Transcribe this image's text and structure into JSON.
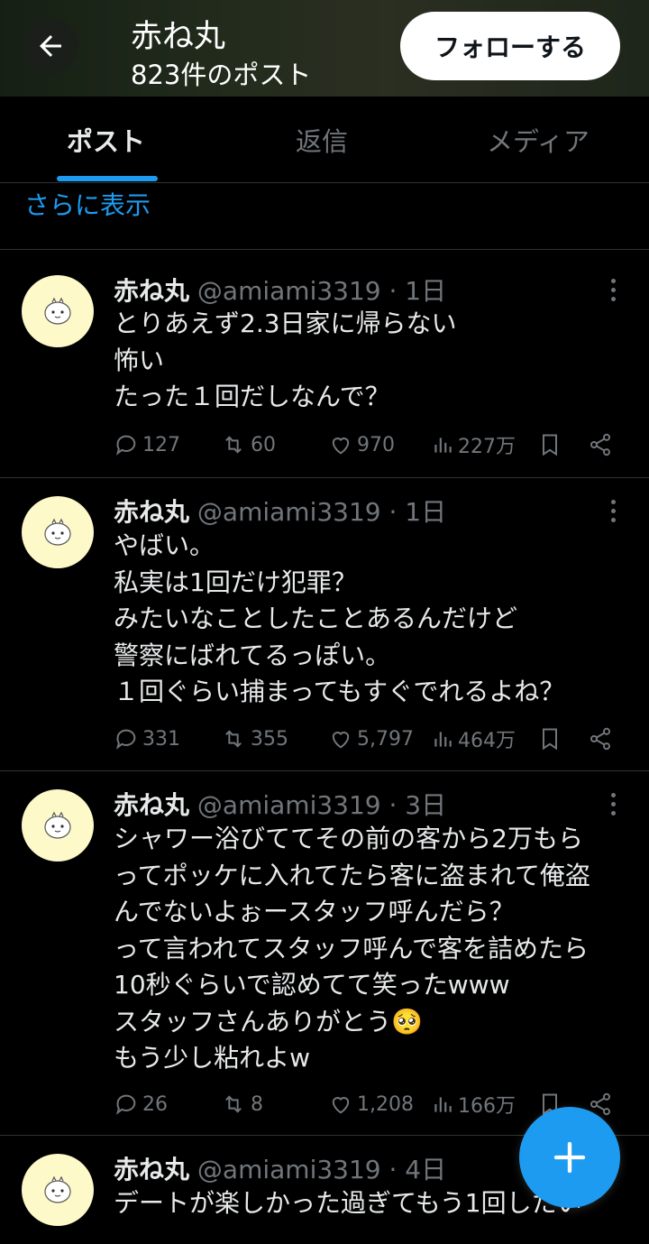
{
  "header": {
    "title": "赤ね丸",
    "post_count": "823件のポスト",
    "follow_label": "フォローする"
  },
  "tabs": [
    {
      "label": "ポスト",
      "active": true
    },
    {
      "label": "返信",
      "active": false
    },
    {
      "label": "メディア",
      "active": false
    }
  ],
  "show_more": "さらに表示",
  "posts": [
    {
      "name": "赤ね丸",
      "meta": "@amiami3319 · 1日",
      "text": "とりあえず2.3日家に帰らない\n怖い\nたった１回だしなんで？",
      "replies": "127",
      "reposts": "60",
      "likes": "970",
      "views": "227万"
    },
    {
      "name": "赤ね丸",
      "meta": "@amiami3319 · 1日",
      "text": "やばい。\n私実は1回だけ犯罪？\nみたいなことしたことあるんだけど\n警察にばれてるっぽい。\n１回ぐらい捕まってもすぐでれるよね？",
      "replies": "331",
      "reposts": "355",
      "likes": "5,797",
      "views": "464万"
    },
    {
      "name": "赤ね丸",
      "meta": "@amiami3319 · 3日",
      "text": "シャワー浴びててその前の客から2万もら\nってポッケに入れてたら客に盗まれて俺盗\nんでないよぉースタッフ呼んだら？\nって言われてスタッフ呼んで客を詰めたら\n10秒ぐらいで認めてて笑ったwww\nスタッフさんありがとう🥺\nもう少し粘れよw",
      "replies": "26",
      "reposts": "8",
      "likes": "1,208",
      "views": "166万"
    },
    {
      "name": "赤ね丸",
      "meta": "@amiami3319 · 4日",
      "text": "デートが楽しかった過ぎてもう1回したい",
      "replies": "",
      "reposts": "",
      "likes": "",
      "views": ""
    }
  ],
  "colors": {
    "accent": "#1d9bf0",
    "muted": "#71767b",
    "text": "#e7e9ea",
    "background": "#000000",
    "avatar_bg": "#fdf9c9"
  },
  "icons": {
    "back": "arrow-left-icon",
    "more": "more-vertical-icon",
    "reply": "reply-icon",
    "repost": "repost-icon",
    "like": "heart-icon",
    "views": "views-bar-icon",
    "bookmark": "bookmark-icon",
    "share": "share-icon",
    "compose": "plus-icon"
  }
}
